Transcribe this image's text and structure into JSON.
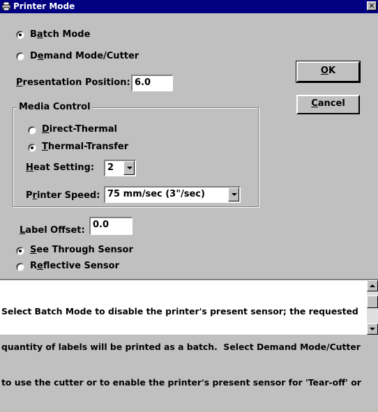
{
  "window": {
    "title": "Printer Mode",
    "close_glyph": "✕"
  },
  "mode": {
    "batch": {
      "prefix": "B",
      "accel": "a",
      "rest": "tch Mode",
      "checked": true
    },
    "demand": {
      "prefix": "D",
      "accel": "e",
      "rest": "mand Mode/Cutter",
      "checked": false
    }
  },
  "presentation": {
    "accel": "P",
    "rest": "resentation Position:",
    "value": "6.0"
  },
  "buttons": {
    "ok_accel": "O",
    "ok_rest": "K",
    "cancel_accel": "C",
    "cancel_rest": "ancel"
  },
  "media": {
    "label": "Media Control",
    "direct": {
      "accel": "D",
      "rest": "irect-Thermal",
      "checked": false
    },
    "transfer": {
      "accel": "T",
      "rest": "hermal-Transfer",
      "checked": true
    },
    "heat": {
      "accel": "H",
      "rest": "eat Setting:",
      "value": "2"
    },
    "speed": {
      "prefix": "P",
      "accel": "r",
      "rest": "inter Speed:",
      "value": "75 mm/sec (3\"/sec)"
    }
  },
  "label_offset": {
    "accel": "L",
    "rest": "abel Offset:",
    "value": "0.0"
  },
  "sensor": {
    "see_through": {
      "accel": "S",
      "rest": "ee Through Sensor",
      "checked": true
    },
    "reflective": {
      "prefix": "R",
      "accel": "e",
      "rest": "flective Sensor",
      "checked": false
    }
  },
  "help": {
    "lines": [
      "Select Batch Mode to disable the printer's present sensor; the requested",
      "quantity of labels will be printed as a batch.  Select Demand Mode/Cutter",
      "to use the cutter or to enable the printer's present sensor for 'Tear-off' or"
    ]
  }
}
